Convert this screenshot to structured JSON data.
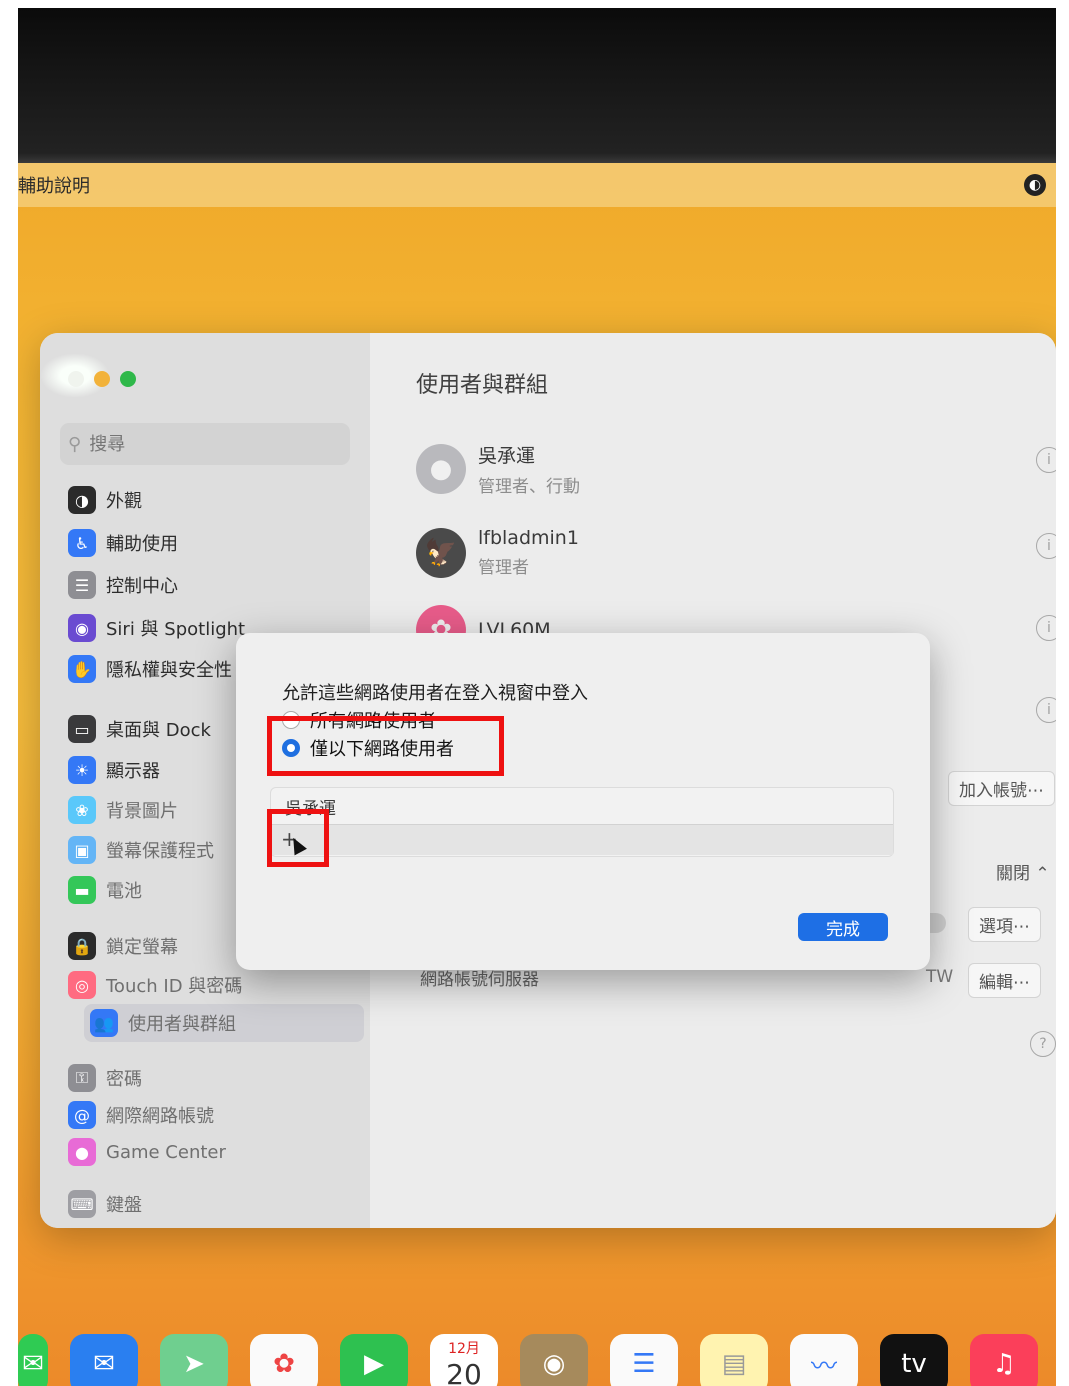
{
  "menubar": {
    "help_label": "輔助說明"
  },
  "sidebar": {
    "search_placeholder": "搜尋",
    "items": [
      {
        "label": "外觀"
      },
      {
        "label": "輔助使用"
      },
      {
        "label": "控制中心"
      },
      {
        "label": "Siri 與 Spotlight"
      },
      {
        "label": "隱私權與安全性"
      },
      {
        "label": "桌面與 Dock"
      },
      {
        "label": "顯示器"
      },
      {
        "label": "背景圖片"
      },
      {
        "label": "螢幕保護程式"
      },
      {
        "label": "電池"
      },
      {
        "label": "鎖定螢幕"
      },
      {
        "label": "Touch ID 與密碼"
      },
      {
        "label": "使用者與群組"
      },
      {
        "label": "密碼"
      },
      {
        "label": "網際網路帳號"
      },
      {
        "label": "Game Center"
      },
      {
        "label": "鍵盤"
      }
    ]
  },
  "main": {
    "title": "使用者與群組",
    "users": [
      {
        "name": "吳承運",
        "role": "管理者、行動"
      },
      {
        "name": "lfbladmin1",
        "role": "管理者"
      },
      {
        "name": "LVL60M",
        "role": ""
      }
    ],
    "add_account_label": "加入帳號⋯",
    "auto_login_value": "關閉",
    "options_label": "選項⋯",
    "network_account_server_label": "網路帳號伺服器",
    "network_server_value": "TW",
    "edit_label": "編輯⋯",
    "help_button": "?"
  },
  "dialog": {
    "prompt": "允許這些網路使用者在登入視窗中登入",
    "option_all": "所有網路使用者",
    "option_only": "僅以下網路使用者",
    "list_user": "吳承運",
    "add_symbol": "+",
    "done_label": "完成"
  },
  "dock": {
    "calendar_month": "12月",
    "calendar_day": "20",
    "tv_label": "tv"
  },
  "colors": {
    "accent": "#1e6fe5",
    "highlight": "#ee1111",
    "wallpaper": "#f3b534"
  }
}
